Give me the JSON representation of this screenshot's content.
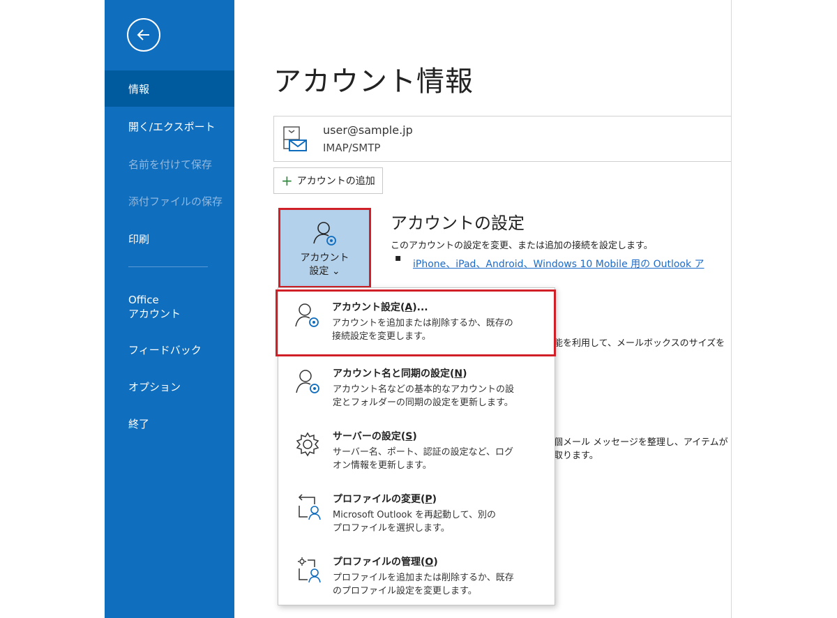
{
  "sidebar": {
    "items": [
      {
        "label": "情報"
      },
      {
        "label": "開く/エクスポート"
      },
      {
        "label": "名前を付けて保存"
      },
      {
        "label": "添付ファイルの保存"
      },
      {
        "label": "印刷"
      },
      {
        "label_line1": "Office",
        "label_line2": "アカウント"
      },
      {
        "label": "フィードバック"
      },
      {
        "label": "オプション"
      },
      {
        "label": "終了"
      }
    ]
  },
  "main": {
    "title": "アカウント情報",
    "account": {
      "email": "user@sample.jp",
      "type": "IMAP/SMTP"
    },
    "add_account_label": "アカウントの追加",
    "settings_button": {
      "line1": "アカウント",
      "line2": "設定 ⌄"
    },
    "section": {
      "title": "アカウントの設定",
      "description": "このアカウントの設定を変更、または追加の接続を設定します。",
      "bullet": "▪",
      "link": "iPhone、iPad、Android、Windows 10 Mobile 用の Outlook ア"
    },
    "background_text": {
      "line1": "能を利用して、メールボックスのサイズを",
      "line2a": "個メール メッセージを整理し、アイテムが",
      "line2b": "取ります。"
    }
  },
  "dropdown": {
    "items": [
      {
        "title": "アカウント設定(",
        "key": "A",
        "title_end": ")...",
        "desc1": "アカウントを追加または削除するか、既存の",
        "desc2": "接続設定を変更します。"
      },
      {
        "title": "アカウント名と同期の設定(",
        "key": "N",
        "title_end": ")",
        "desc1": "アカウント名などの基本的なアカウントの設",
        "desc2": "定とフォルダーの同期の設定を更新します。"
      },
      {
        "title": "サーバーの設定(",
        "key": "S",
        "title_end": ")",
        "desc1": "サーバー名、ポート、認証の設定など、ログ",
        "desc2": "オン情報を更新します。"
      },
      {
        "title": "プロファイルの変更(",
        "key": "P",
        "title_end": ")",
        "desc1": "Microsoft Outlook を再起動して、別の",
        "desc2": "プロファイルを選択します。"
      },
      {
        "title": "プロファイルの管理(",
        "key": "O",
        "title_end": ")",
        "desc1": "プロファイルを追加または削除するか、既存",
        "desc2": "のプロファイル設定を変更します。"
      }
    ]
  },
  "colors": {
    "sidebar": "#106ebe",
    "sidebar_active": "#005a9e",
    "highlight": "#d01f26",
    "button_bg": "#b4d1eb",
    "link": "#1b6ac9"
  }
}
